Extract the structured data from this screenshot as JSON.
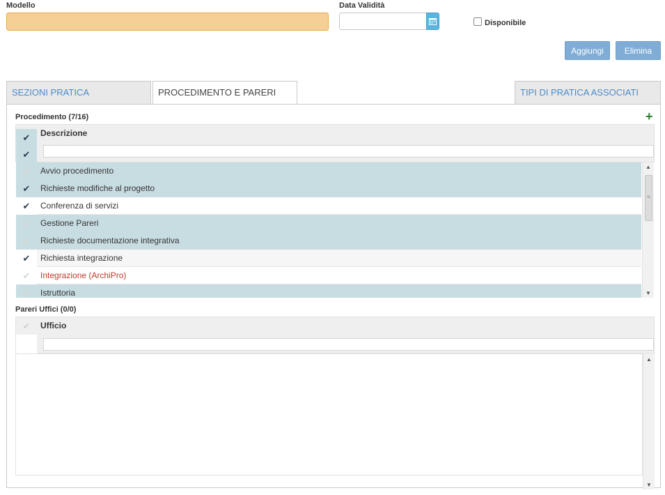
{
  "form": {
    "modello_label": "Modello",
    "modello_value": "",
    "data_validita_label": "Data Validità",
    "data_validita_value": "",
    "disponibile_label": "Disponibile",
    "disponibile_checked": false
  },
  "actions": {
    "add_label": "Aggiungi",
    "delete_label": "Elimina"
  },
  "tabs": [
    {
      "label": "SEZIONI PRATICA",
      "active": false
    },
    {
      "label": "PROCEDIMENTO E PARERI",
      "active": true
    },
    {
      "label": "TIPI DI PRATICA ASSOCIATI",
      "active": false
    }
  ],
  "procedimento": {
    "title": "Procedimento (7/16)",
    "column": "Descrizione",
    "filter_value": "",
    "rows": [
      {
        "label": "Avvio procedimento",
        "checked": false,
        "selected": true
      },
      {
        "label": "Richieste modifiche al progetto",
        "checked": true,
        "selected": true
      },
      {
        "label": "Conferenza di servizi",
        "checked": true,
        "selected": false
      },
      {
        "label": "Gestione Pareri",
        "checked": false,
        "selected": true
      },
      {
        "label": "Richieste documentazione integrativa",
        "checked": false,
        "selected": true
      },
      {
        "label": "Richiesta integrazione",
        "checked": true,
        "selected": false
      },
      {
        "label": "Integrazione (ArchiPro)",
        "checked": false,
        "selected": false,
        "red": true
      },
      {
        "label": "Istruttoria",
        "checked": false,
        "selected": true
      }
    ]
  },
  "pareri": {
    "title": "Pareri Uffici (0/0)",
    "column": "Ufficio",
    "filter_value": "",
    "rows": []
  },
  "colors": {
    "accent": "#7fadd6",
    "selected_row": "#c8dde2",
    "required_field": "#f6cf97",
    "add_icon": "#2e7d32"
  }
}
